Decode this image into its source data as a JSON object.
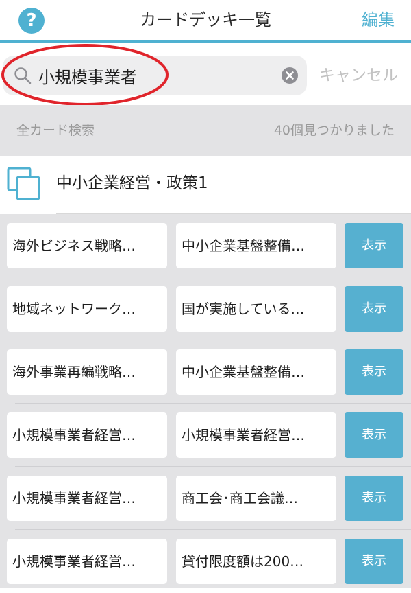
{
  "header": {
    "help_label": "?",
    "title": "カードデッキ一覧",
    "edit_label": "編集"
  },
  "search": {
    "value": "小規模事業者",
    "cancel_label": "キャンセル"
  },
  "filter": {
    "label": "全カード検索",
    "result_count": "40個見つかりました"
  },
  "deck": {
    "title": "中小企業経営・政策1"
  },
  "cards": [
    {
      "front": "海外ビジネス戦略…",
      "back": "中小企業基盤整備…",
      "button": "表示"
    },
    {
      "front": "地域ネットワーク…",
      "back": "国が実施している…",
      "button": "表示"
    },
    {
      "front": "海外事業再編戦略…",
      "back": "中小企業基盤整備…",
      "button": "表示"
    },
    {
      "front": "小規模事業者経営…",
      "back": "小規模事業者経営…",
      "button": "表示"
    },
    {
      "front": "小規模事業者経営…",
      "back": "商工会･商工会議…",
      "button": "表示"
    },
    {
      "front": "小規模事業者経営…",
      "back": "貸付限度額は200…",
      "button": "表示"
    }
  ],
  "colors": {
    "accent": "#4fb1d1",
    "button": "#56b0d0",
    "highlight_ellipse": "#e0242b",
    "list_background": "#e3e3e5",
    "cancel_text": "#c2c2c2"
  },
  "icons": {
    "help": "help-icon",
    "search": "search-icon",
    "clear": "clear-icon",
    "deck": "deck-icon"
  }
}
